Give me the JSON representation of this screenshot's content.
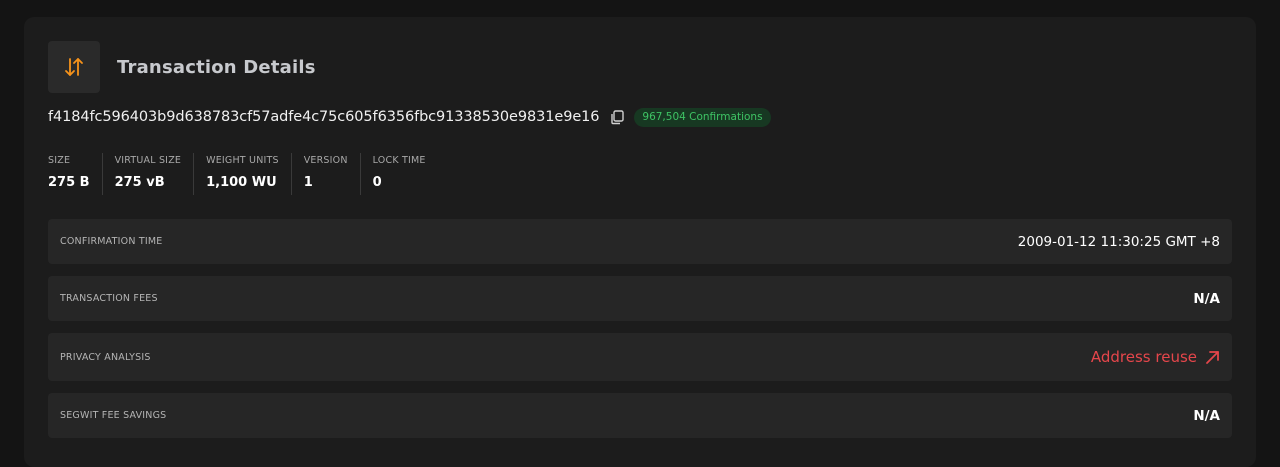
{
  "header": {
    "title": "Transaction Details",
    "icon": "arrows-up-down-icon",
    "accent_color": "#f7931a"
  },
  "transaction": {
    "hash": "f4184fc596403b9d638783cf57adfe4c75c605f6356fbc91338530e9831e9e16",
    "confirmations": "967,504 Confirmations"
  },
  "stats": [
    {
      "label": "SIZE",
      "value": "275 B"
    },
    {
      "label": "VIRTUAL SIZE",
      "value": "275 vB"
    },
    {
      "label": "WEIGHT UNITS",
      "value": "1,100 WU"
    },
    {
      "label": "VERSION",
      "value": "1"
    },
    {
      "label": "LOCK TIME",
      "value": "0"
    }
  ],
  "details": {
    "confirmation_time": {
      "label": "CONFIRMATION TIME",
      "value": "2009-01-12 11:30:25 GMT +8"
    },
    "transaction_fees": {
      "label": "TRANSACTION FEES",
      "value": "N/A"
    },
    "privacy_analysis": {
      "label": "PRIVACY ANALYSIS",
      "value": "Address reuse"
    },
    "segwit_fee_savings": {
      "label": "SEGWIT FEE SAVINGS",
      "value": "N/A"
    }
  },
  "colors": {
    "badge_text": "#3ec364",
    "warning": "#e5464b"
  }
}
